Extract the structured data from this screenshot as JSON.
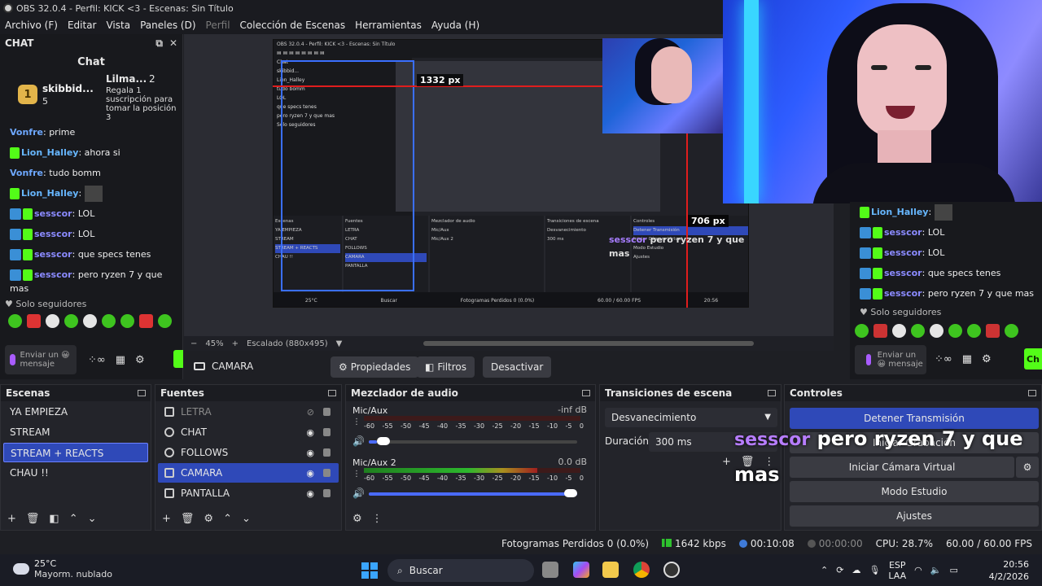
{
  "window": {
    "title": "OBS 32.0.4 - Perfil: KICK <3 - Escenas: Sin Título"
  },
  "menu": [
    "Archivo (F)",
    "Editar",
    "Vista",
    "Paneles (D)",
    "Perfil",
    "Colección de Escenas",
    "Herramientas",
    "Ayuda (H)"
  ],
  "chat": {
    "dock_title": "CHAT",
    "header": "Chat",
    "gift": {
      "name": "skibbid...",
      "rank": "1",
      "count": "5",
      "name2": "Lilma...",
      "count2": "2",
      "text": "Regala 1 suscripción para tomar la posición 3"
    },
    "messages": [
      {
        "user": "Vonfre",
        "text": "prime"
      },
      {
        "user": "Lion_Halley",
        "text": "ahora si"
      },
      {
        "user": "Vonfre",
        "text": "tudo bomm"
      },
      {
        "user": "Lion_Halley",
        "text": ""
      },
      {
        "user": "sesscor",
        "text": "LOL"
      },
      {
        "user": "sesscor",
        "text": "LOL"
      },
      {
        "user": "sesscor",
        "text": "que specs tenes"
      },
      {
        "user": "sesscor",
        "text": "pero ryzen 7 y que mas"
      }
    ],
    "solo_label": "Solo seguidores",
    "input_placeholder": "Enviar un 😀 mensaje",
    "send_label": "Ch"
  },
  "right_chat": {
    "messages": [
      {
        "user": "Lion_Halley",
        "text": ""
      },
      {
        "user": "sesscor",
        "text": "LOL"
      },
      {
        "user": "sesscor",
        "text": "LOL"
      },
      {
        "user": "sesscor",
        "text": "que specs tenes"
      },
      {
        "user": "sesscor",
        "text": "pero ryzen 7 y que mas"
      }
    ]
  },
  "preview": {
    "measure_h": "1332 px",
    "measure_v": "706 px",
    "nested_overlay_user": "sesscor",
    "nested_overlay_text": "pero ryzen 7 y que mas",
    "zoom": "45%",
    "scale": "Escalado (880x495)"
  },
  "source_toolbar": {
    "source_name": "CAMARA",
    "properties": "Propiedades",
    "filters": "Filtros",
    "deactivate": "Desactivar"
  },
  "scenes": {
    "title": "Escenas",
    "items": [
      "YA EMPIEZA",
      "STREAM",
      "STREAM + REACTS",
      "CHAU !!"
    ],
    "selected": "STREAM + REACTS"
  },
  "sources": {
    "title": "Fuentes",
    "items": [
      {
        "name": "LETRA",
        "icon": "image-icon",
        "visible": false
      },
      {
        "name": "CHAT",
        "icon": "browser-icon",
        "visible": true
      },
      {
        "name": "FOLLOWS",
        "icon": "browser-icon",
        "visible": true
      },
      {
        "name": "CAMARA",
        "icon": "camera-icon",
        "visible": true
      },
      {
        "name": "PANTALLA",
        "icon": "monitor-icon",
        "visible": true
      }
    ],
    "selected": "CAMARA"
  },
  "mixer": {
    "title": "Mezclador de audio",
    "ticks": [
      "-60",
      "-55",
      "-50",
      "-45",
      "-40",
      "-35",
      "-30",
      "-25",
      "-20",
      "-15",
      "-10",
      "-5",
      "0"
    ],
    "channels": [
      {
        "name": "Mic/Aux",
        "db": "-inf dB",
        "level": 0.0,
        "volume": 0.04
      },
      {
        "name": "Mic/Aux 2",
        "db": "0.0 dB",
        "level": 0.8,
        "volume": 1.0
      }
    ]
  },
  "transitions": {
    "title": "Transiciones de escena",
    "selected": "Desvanecimiento",
    "duration_label": "Duración",
    "duration_value": "300 ms"
  },
  "controls": {
    "title": "Controles",
    "stop_stream": "Detener Transmisión",
    "record": "Iniciar Grabación",
    "virtual_cam": "Iniciar Cámara Virtual",
    "studio_mode": "Modo Estudio",
    "settings": "Ajustes"
  },
  "overlay_chat": {
    "user": "sesscor",
    "text": "pero ryzen 7 y que mas"
  },
  "status": {
    "dropped": "Fotogramas Perdidos 0 (0.0%)",
    "bitrate": "1642 kbps",
    "stream_time": "00:10:08",
    "rec_time": "00:00:00",
    "cpu": "CPU: 28.7%",
    "fps": "60.00 / 60.00 FPS"
  },
  "taskbar": {
    "temp": "25°C",
    "weather": "Mayorm. nublado",
    "search": "Buscar",
    "lang1": "ESP",
    "lang2": "LAA",
    "time": "20:56",
    "date": "4/2/2026"
  },
  "colors": {
    "accent": "#2f49b8",
    "kick_green": "#53fc18",
    "measure_red": "#e01d1d"
  }
}
